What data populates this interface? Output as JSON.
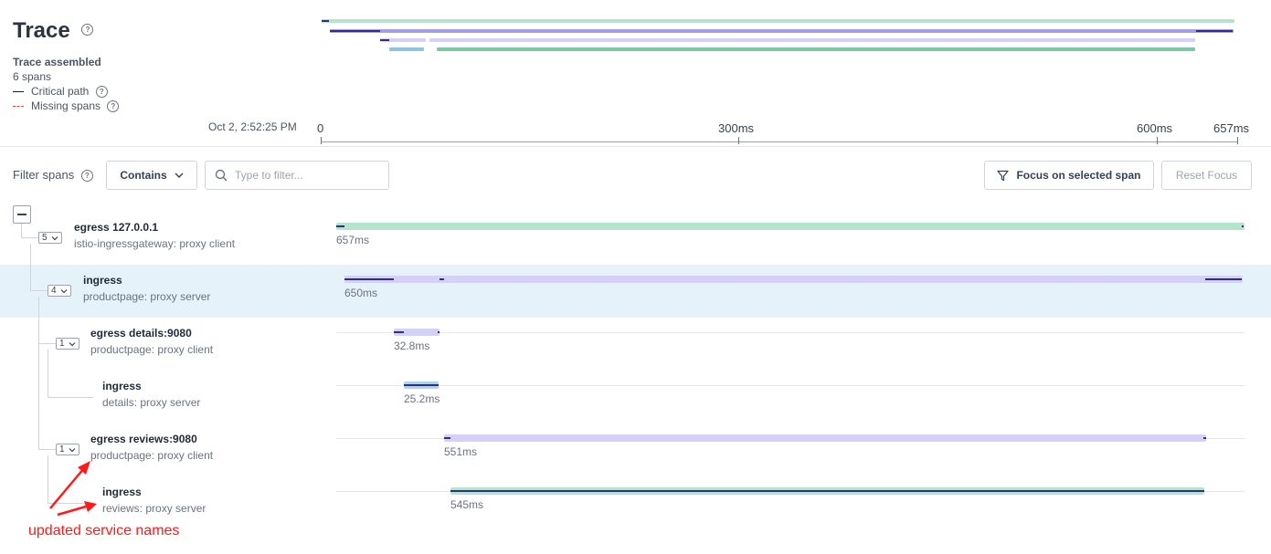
{
  "header": {
    "title": "Trace",
    "status": "Trace assembled",
    "span_count": "6 spans",
    "legend": [
      {
        "label": "Critical path",
        "style": "solid"
      },
      {
        "label": "Missing spans",
        "style": "dashed"
      }
    ]
  },
  "timeline": {
    "start_time": "Oct 2, 2:52:25 PM",
    "ticks": [
      "0",
      "300ms",
      "600ms",
      "657ms"
    ]
  },
  "filters": {
    "label": "Filter spans",
    "mode": "Contains",
    "placeholder": "Type to filter...",
    "focus_button": "Focus on selected span",
    "reset_button": "Reset Focus"
  },
  "spans": [
    {
      "name": "egress 127.0.0.1",
      "service": "istio-ingressgateway: proxy client",
      "duration": "657ms",
      "children": "5",
      "selected": false
    },
    {
      "name": "ingress",
      "service": "productpage: proxy server",
      "duration": "650ms",
      "children": "4",
      "selected": true
    },
    {
      "name": "egress details:9080",
      "service": "productpage: proxy client",
      "duration": "32.8ms",
      "children": "1",
      "selected": false
    },
    {
      "name": "ingress",
      "service": "details: proxy server",
      "duration": "25.2ms",
      "children": "",
      "selected": false
    },
    {
      "name": "egress reviews:9080",
      "service": "productpage: proxy client",
      "duration": "551ms",
      "children": "1",
      "selected": false
    },
    {
      "name": "ingress",
      "service": "reviews: proxy server",
      "duration": "545ms",
      "children": "",
      "selected": false
    }
  ],
  "annotation": {
    "text": "updated service names",
    "color": "#ff1a1a"
  },
  "colors": {
    "green_bar": "#b4e5cc",
    "purple_bar": "#d5d0f7",
    "blue_bar": "#a9d4ea",
    "selected_row": "#e6f2fa",
    "critical_path": "#312e81"
  }
}
